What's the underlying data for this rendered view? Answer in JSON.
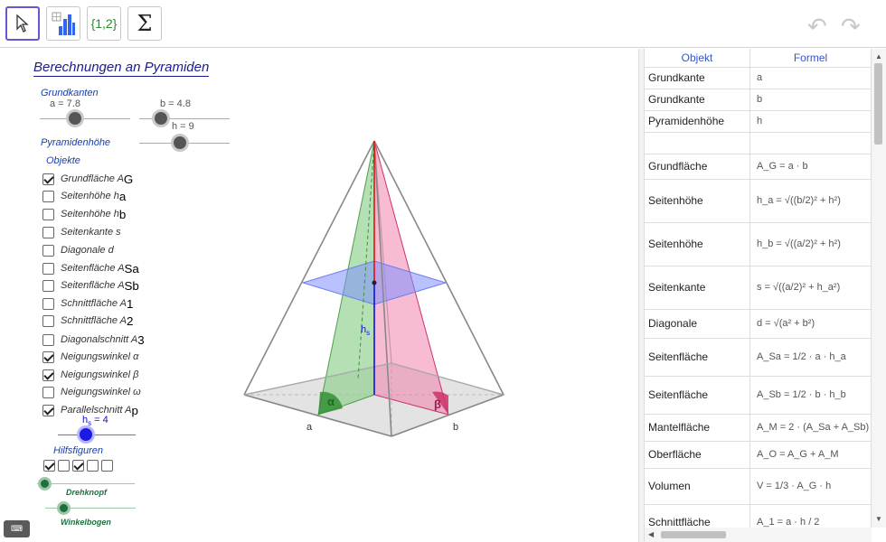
{
  "toolbar": {
    "tools": [
      {
        "name": "move-tool",
        "icon": "pointer-arrow-icon"
      },
      {
        "name": "chart-tool",
        "icon": "bar-chart-icon"
      },
      {
        "name": "list-tool",
        "label": "{1,2}"
      },
      {
        "name": "sum-tool",
        "label": "Σ"
      }
    ],
    "undo": "↶",
    "redo": "↷"
  },
  "graphics": {
    "title": "Berechnungen an Pyramiden",
    "grundkanten_label": "Grundkanten",
    "pyramidenhoehe_label": "Pyramidenhöhe",
    "objekte_label": "Objekte",
    "slider_a": "a = 7.8",
    "slider_b": "b = 4.8",
    "slider_h": "h = 9",
    "slider_hs": "h",
    "slider_hs_sub": "s",
    "slider_hs_value": " = 4",
    "checkboxes": [
      {
        "text": "Grundfläche A",
        "sub": "G",
        "checked": true
      },
      {
        "text": "Seitenhöhe h",
        "sub": "a",
        "checked": false
      },
      {
        "text": "Seitenhöhe h",
        "sub": "b",
        "checked": false
      },
      {
        "text": "Seitenkante s",
        "sub": "",
        "checked": false
      },
      {
        "text": "Diagonale d",
        "sub": "",
        "checked": false
      },
      {
        "text": "Seitenfläche A",
        "sub": "Sa",
        "checked": false
      },
      {
        "text": "Seitenfläche A",
        "sub": "Sb",
        "checked": false
      },
      {
        "text": "Schnittfläche A",
        "sub": "1",
        "checked": false
      },
      {
        "text": "Schnittfläche A",
        "sub": "2",
        "checked": false
      },
      {
        "text": "Diagonalschnitt A",
        "sub": "3",
        "checked": false
      },
      {
        "text": "Neigungswinkel α",
        "sub": "",
        "checked": true
      },
      {
        "text": "Neigungswinkel β",
        "sub": "",
        "checked": true
      },
      {
        "text": "Neigungswinkel ω",
        "sub": "",
        "checked": false
      },
      {
        "text": "Parallelschnitt A",
        "sub": "p",
        "checked": true
      }
    ],
    "hilfsfiguren_label": "Hilfsfiguren",
    "aux_checks": [
      true,
      false,
      true,
      false,
      false
    ],
    "drehknopf_label": "Drehknopf",
    "winkelbogen_label": "Winkelbogen",
    "keyboard_label": "⌨",
    "labels3d": {
      "alpha": "α",
      "beta": "β",
      "a": "a",
      "b": "b",
      "hs": "h",
      "hs_sub": "s"
    }
  },
  "table": {
    "headers": [
      "Objekt",
      "Formel"
    ],
    "rows": [
      {
        "obj": "Grundkante",
        "formula": "a"
      },
      {
        "obj": "Grundkante",
        "formula": "b"
      },
      {
        "obj": "Pyramidenhöhe",
        "formula": "h"
      },
      {
        "obj": "",
        "formula": ""
      },
      {
        "obj": "Grundfläche",
        "formula": "A_G = a · b"
      },
      {
        "obj": "Seitenhöhe",
        "formula": "h_a = √((b/2)² + h²)"
      },
      {
        "obj": "Seitenhöhe",
        "formula": "h_b = √((a/2)² + h²)"
      },
      {
        "obj": "Seitenkante",
        "formula": "s = √((a/2)² + h_a²)"
      },
      {
        "obj": "Diagonale",
        "formula": "d = √(a² + b²)"
      },
      {
        "obj": "Seitenfläche",
        "formula": "A_Sa = 1/2 · a · h_a"
      },
      {
        "obj": "Seitenfläche",
        "formula": "A_Sb = 1/2 · b · h_b"
      },
      {
        "obj": "Mantelfläche",
        "formula": "A_M = 2 · (A_Sa + A_Sb)"
      },
      {
        "obj": "Oberfläche",
        "formula": "A_O = A_G + A_M"
      },
      {
        "obj": "Volumen",
        "formula": "V = 1/3 · A_G · h"
      },
      {
        "obj": "Schnittfläche",
        "formula": "A_1 = a · h / 2"
      }
    ]
  }
}
